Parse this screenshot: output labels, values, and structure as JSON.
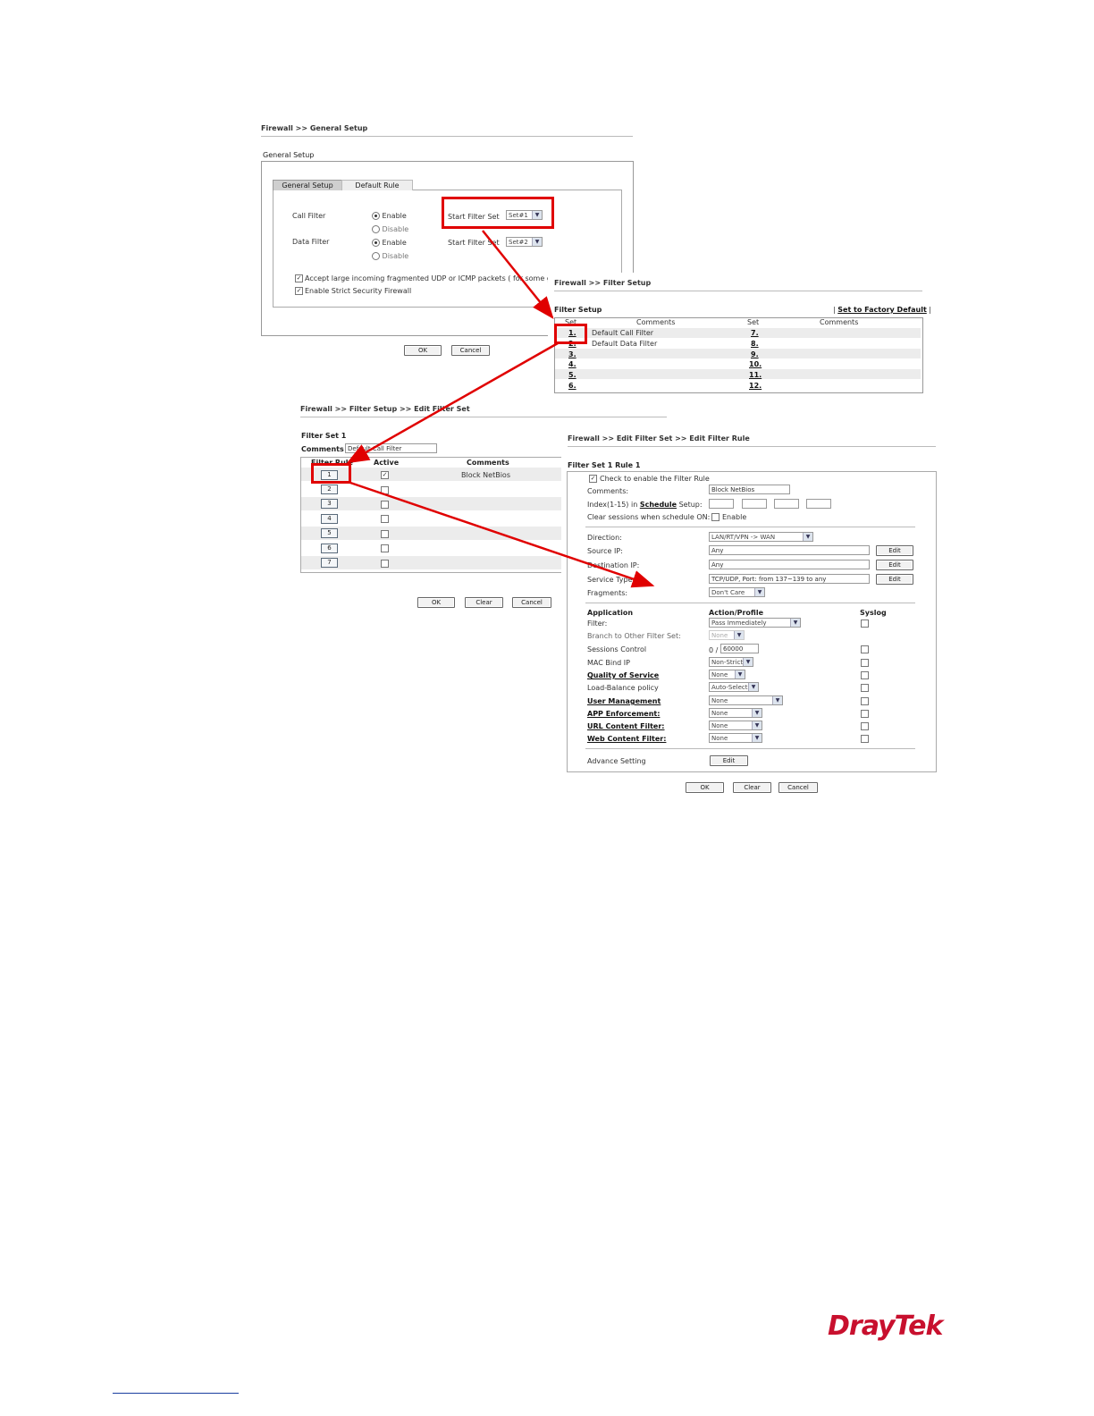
{
  "general": {
    "breadcrumb": "Firewall >> General Setup",
    "section_title": "General Setup",
    "tabs": [
      "General Setup",
      "Default Rule"
    ],
    "call_filter_label": "Call Filter",
    "data_filter_label": "Data Filter",
    "enable": "Enable",
    "disable": "Disable",
    "start_filter_set": "Start Filter Set",
    "call_set_value": "Set#1",
    "data_set_value": "Set#2",
    "accept_large": "Accept large incoming fragmented UDP or ICMP packets ( for some g",
    "strict_security": "Enable Strict Security Firewall",
    "ok": "OK",
    "cancel": "Cancel"
  },
  "filter_setup": {
    "breadcrumb": "Firewall >> Filter Setup",
    "title": "Filter Setup",
    "factory_default": "Set to Factory Default",
    "col_set": "Set",
    "col_comments": "Comments",
    "left_sets": [
      "1.",
      "2.",
      "3.",
      "4.",
      "5.",
      "6."
    ],
    "left_comments": [
      "Default Call Filter",
      "Default Data Filter",
      "",
      "",
      "",
      ""
    ],
    "right_sets": [
      "7.",
      "8.",
      "9.",
      "10.",
      "11.",
      "12."
    ]
  },
  "edit_set": {
    "breadcrumb": "Firewall >> Filter Setup >> Edit Filter Set",
    "title": "Filter Set 1",
    "comments_label": "Comments :",
    "comments_value": "Default Call Filter",
    "col_rule": "Filter Rule",
    "col_active": "Active",
    "col_comments": "Comments",
    "rules": [
      "1",
      "2",
      "3",
      "4",
      "5",
      "6",
      "7"
    ],
    "rule1_comment": "Block NetBios",
    "ok": "OK",
    "clear": "Clear",
    "cancel": "Cancel"
  },
  "edit_rule": {
    "breadcrumb": "Firewall >> Edit Filter Set >> Edit Filter Rule",
    "title": "Filter Set 1 Rule 1",
    "check_enable": "Check to enable the Filter Rule",
    "comments_label": "Comments:",
    "comments_value": "Block NetBios",
    "index_label": "Index(1-15) in",
    "schedule_link": "Schedule",
    "setup_suffix": "Setup:",
    "clear_sessions": "Clear sessions when schedule ON:",
    "enable": "Enable",
    "direction_label": "Direction:",
    "direction_value": "LAN/RT/VPN -> WAN",
    "source_label": "Source IP:",
    "source_value": "Any",
    "dest_label": "Destination IP:",
    "dest_value": "Any",
    "service_label": "Service Type:",
    "service_value": "TCP/UDP, Port: from 137~139 to any",
    "fragments_label": "Fragments:",
    "fragments_value": "Don't Care",
    "edit": "Edit",
    "col_application": "Application",
    "col_action": "Action/Profile",
    "col_syslog": "Syslog",
    "filter_label": "Filter:",
    "filter_value": "Pass Immediately",
    "branch_label": "Branch to Other Filter Set:",
    "branch_value": "None",
    "sessions_label": "Sessions Control",
    "sessions_prefix": "0 /",
    "sessions_value": "60000",
    "mac_label": "MAC Bind IP",
    "mac_value": "Non-Strict",
    "qos_label": "Quality of Service",
    "qos_value": "None",
    "lb_label": "Load-Balance policy",
    "lb_value": "Auto-Select",
    "um_label": "User Management",
    "um_value": "None",
    "app_label": "APP Enforcement:",
    "app_value": "None",
    "url_label": "URL Content Filter:",
    "url_value": "None",
    "web_label": "Web Content Filter:",
    "web_value": "None",
    "advance_label": "Advance Setting",
    "ok": "OK",
    "clear": "Clear",
    "cancel": "Cancel"
  },
  "brand": {
    "logo": "DrayTek",
    "color": "#c8102e"
  },
  "colors": {
    "highlight": "#e00000"
  }
}
